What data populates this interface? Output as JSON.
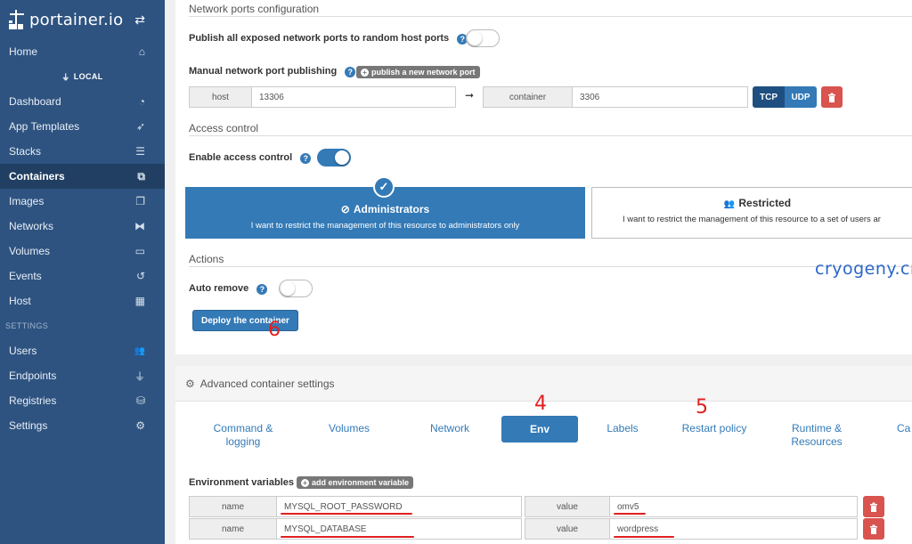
{
  "brand": {
    "logo_text": "portainer.io",
    "toggle_icon": "swap-arrows-icon"
  },
  "sidebar": {
    "endpoint": "LOCAL",
    "items": [
      {
        "label": "Home",
        "icon": "home-icon",
        "glyph": "⌂"
      },
      {
        "label": "Dashboard",
        "icon": "tachometer-icon",
        "glyph": "◔"
      },
      {
        "label": "App Templates",
        "icon": "rocket-icon",
        "glyph": "➶"
      },
      {
        "label": "Stacks",
        "icon": "list-icon",
        "glyph": "☰"
      },
      {
        "label": "Containers",
        "icon": "cubes-icon",
        "glyph": "⧉",
        "active": true
      },
      {
        "label": "Images",
        "icon": "clone-icon",
        "glyph": "❐"
      },
      {
        "label": "Networks",
        "icon": "sitemap-icon",
        "glyph": "⧓"
      },
      {
        "label": "Volumes",
        "icon": "hdd-icon",
        "glyph": "▭"
      },
      {
        "label": "Events",
        "icon": "history-icon",
        "glyph": "↺"
      },
      {
        "label": "Host",
        "icon": "th-icon",
        "glyph": "▦"
      }
    ],
    "settings_header": "SETTINGS",
    "settings_items": [
      {
        "label": "Users",
        "icon": "users-icon",
        "glyph": "👥"
      },
      {
        "label": "Endpoints",
        "icon": "plug-icon",
        "glyph": "⏚"
      },
      {
        "label": "Registries",
        "icon": "database-icon",
        "glyph": "⛁"
      },
      {
        "label": "Settings",
        "icon": "cogs-icon",
        "glyph": "⚙"
      }
    ]
  },
  "network_ports": {
    "section_title": "Network ports configuration",
    "publish_all_label": "Publish all exposed network ports to random host ports",
    "publish_all_enabled": false,
    "manual_label": "Manual network port publishing",
    "publish_new_button": "publish a new network port",
    "mapping": {
      "host_label": "host",
      "host_value": "13306",
      "container_label": "container",
      "container_value": "3306",
      "tcp_label": "TCP",
      "udp_label": "UDP"
    }
  },
  "access_control": {
    "section_title": "Access control",
    "enable_label": "Enable access control",
    "enabled": true,
    "admin_title": "Administrators",
    "admin_desc": "I want to restrict the management of this resource to administrators only",
    "restricted_title": "Restricted",
    "restricted_desc": "I want to restrict the management of this resource to a set of users ar"
  },
  "actions": {
    "section_title": "Actions",
    "auto_remove_label": "Auto remove",
    "auto_remove_enabled": false,
    "deploy_button": "Deploy the container"
  },
  "watermark": "cryogeny.cn",
  "annotations": {
    "deploy": "6",
    "env": "4",
    "restart": "5"
  },
  "advanced": {
    "title": "Advanced container settings",
    "tabs": [
      {
        "label": "Command & logging"
      },
      {
        "label": "Volumes"
      },
      {
        "label": "Network"
      },
      {
        "label": "Env",
        "active": true
      },
      {
        "label": "Labels"
      },
      {
        "label": "Restart policy"
      },
      {
        "label": "Runtime & Resources"
      },
      {
        "label": "Ca"
      }
    ],
    "env_label": "Environment variables",
    "add_env_button": "add environment variable",
    "env_vars": [
      {
        "name_label": "name",
        "name": "MYSQL_ROOT_PASSWORD",
        "value_label": "value",
        "value": "omv5"
      },
      {
        "name_label": "name",
        "name": "MYSQL_DATABASE",
        "value_label": "value",
        "value": "wordpress"
      }
    ]
  },
  "colors": {
    "sidebar": "#2e5380",
    "primary": "#337ab7",
    "danger": "#d9534f",
    "annotation": "#e02020"
  }
}
